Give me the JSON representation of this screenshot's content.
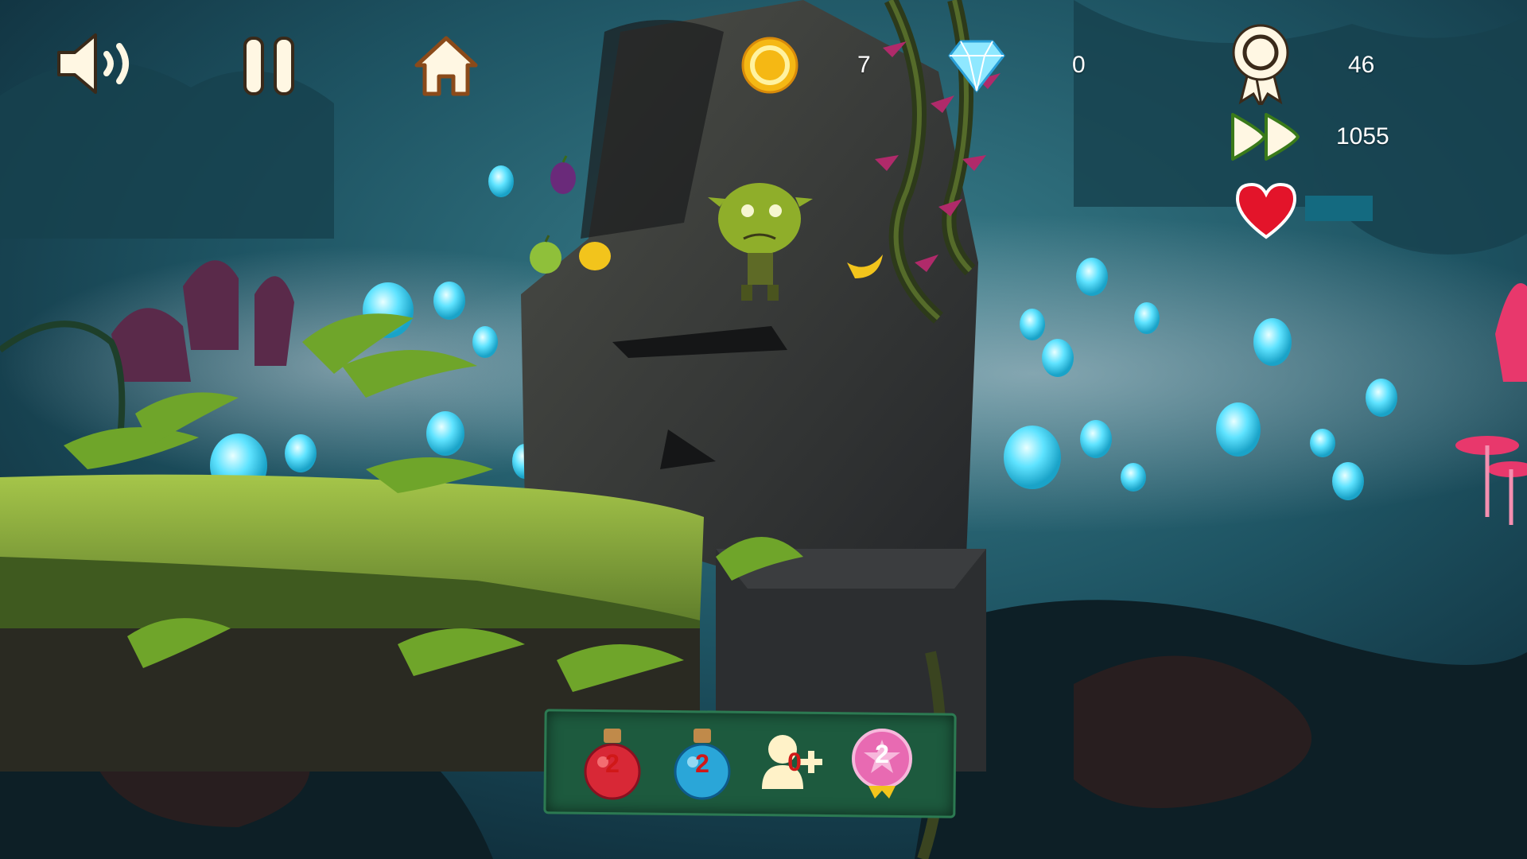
{
  "hud": {
    "icons": {
      "sound": "speaker-icon",
      "pause": "pause-icon",
      "home": "home-icon",
      "coin": "gold-coin-icon",
      "diamond": "diamond-icon",
      "level": "award-ribbon-icon",
      "distance": "fast-forward-icon",
      "health": "heart-icon"
    },
    "coins": "7",
    "diamonds": "0",
    "level": "46",
    "distance": "1055",
    "health_fraction": 1.0
  },
  "powerups": [
    {
      "icon": "red-potion-icon",
      "count": "2"
    },
    {
      "icon": "blue-potion-icon",
      "count": "2"
    },
    {
      "icon": "extra-life-icon",
      "count": "0"
    },
    {
      "icon": "star-badge-icon",
      "count": "2"
    }
  ],
  "colors": {
    "sky": "#1f5a68",
    "glow": "#5fe3ff",
    "moss": "#7fa63a",
    "heart": "#e3142a"
  }
}
